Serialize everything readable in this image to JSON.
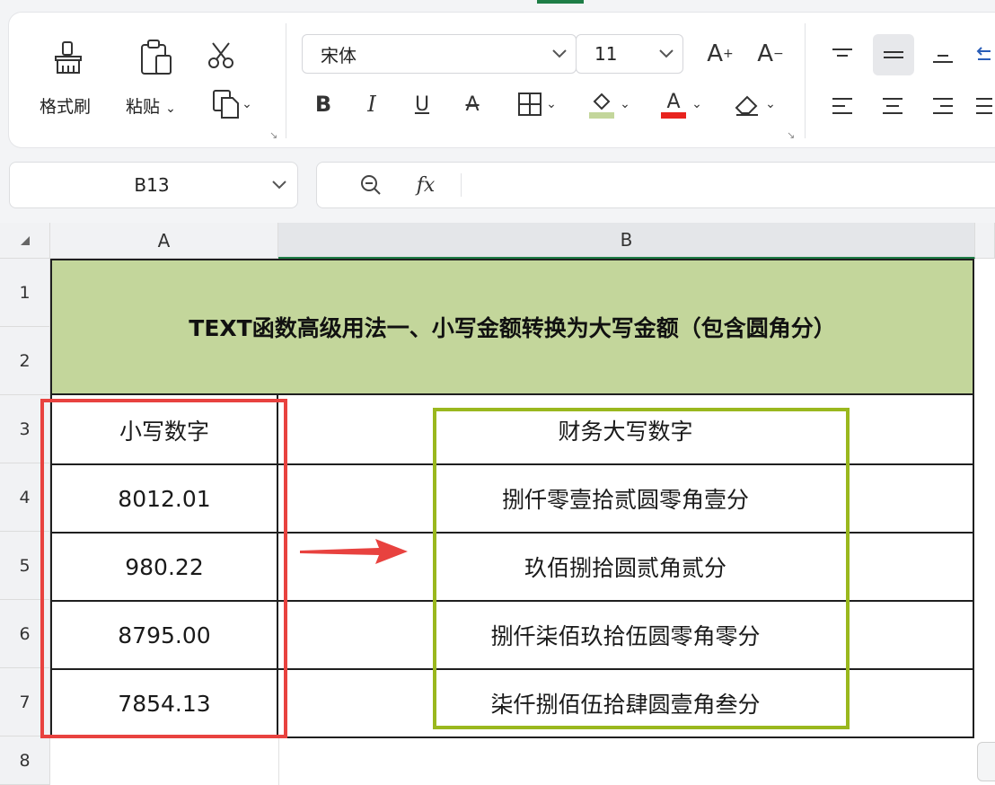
{
  "ribbon": {
    "format_painter_label": "格式刷",
    "paste_label": "粘贴",
    "font_name": "宋体",
    "font_size": "11"
  },
  "name_box": {
    "value": "B13"
  },
  "formula_bar": {
    "fx_label": "fx",
    "value": ""
  },
  "columns": [
    "A",
    "B"
  ],
  "rows": [
    "1",
    "2",
    "3",
    "4",
    "5",
    "6",
    "7",
    "8"
  ],
  "sheet": {
    "title": "TEXT函数高级用法一、小写金额转换为大写金额（包含圆角分）",
    "header_a": "小写数字",
    "header_b": "财务大写数字",
    "data": [
      {
        "a": "8012.01",
        "b": "捌仟零壹拾贰圆零角壹分"
      },
      {
        "a": "980.22",
        "b": "玖佰捌拾圆贰角贰分"
      },
      {
        "a": "8795.00",
        "b": "捌仟柒佰玖拾伍圆零角零分"
      },
      {
        "a": "7854.13",
        "b": "柒仟捌佰伍拾肆圆壹角叁分"
      }
    ]
  },
  "colors": {
    "title_fill": "#c3d69b",
    "red_box": "#e8423f",
    "green_box": "#9ab81e",
    "arrow": "#e8423f",
    "accent": "#1e7d46"
  }
}
